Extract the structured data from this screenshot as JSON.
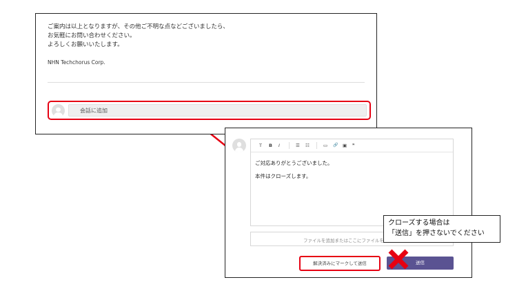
{
  "thread": {
    "message_lines": [
      "ご案内は以上となりますが、その他ご不明な点などございましたら、",
      "お気軽にお問い合わせください。",
      "よろしくお願いいたします。"
    ],
    "company": "NHN Techchorus Corp.",
    "reply_placeholder": "会話に追加"
  },
  "composer": {
    "toolbar": {
      "text_size": "T",
      "bold": "B",
      "italic": "I",
      "bullet_list": "☰",
      "numbered_list": "☷",
      "image": "▭",
      "link": "🔗",
      "media": "▣",
      "quote": "❞"
    },
    "body_lines": [
      "ご対応ありがとうございました。",
      "本件はクローズします。"
    ],
    "attach_text": "ファイルを追加またはここにファイルを",
    "resolve_button": "解決済みにマークして送信",
    "send_button": "送信"
  },
  "callout": {
    "lines": [
      "クローズする場合は",
      "「送信」を押さないでください"
    ]
  },
  "colors": {
    "highlight_red": "#e60012",
    "send_button": "#5a5392"
  }
}
